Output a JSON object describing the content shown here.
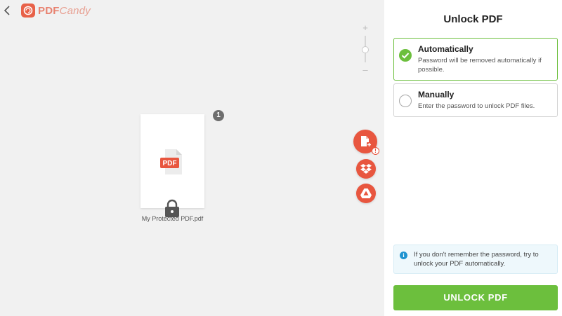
{
  "header": {
    "logo_text_main": "PDF",
    "logo_text_script": "Candy"
  },
  "workspace": {
    "zoom_plus": "+",
    "zoom_minus": "–",
    "zoom_level": 0.5,
    "file_count": "1",
    "file_name": "My Protected PDF.pdf",
    "file_type_label": "PDF",
    "add_warning": "!"
  },
  "panel": {
    "title": "Unlock PDF",
    "options": [
      {
        "title": "Automatically",
        "description": "Password will be removed automatically if possible.",
        "selected": true
      },
      {
        "title": "Manually",
        "description": "Enter the password to unlock PDF files.",
        "selected": false
      }
    ],
    "info_icon": "i",
    "info_text": "If you don't remember the password, try to unlock your PDF automatically.",
    "unlock_button": "UNLOCK PDF"
  },
  "colors": {
    "brand": "#e8563f",
    "accent_green": "#6cbf3d",
    "info_blue": "#1f93d0"
  },
  "icons": [
    "back-icon",
    "pdfcandy-logo-icon",
    "pdf-file-icon",
    "lock-icon",
    "add-file-icon",
    "dropbox-icon",
    "google-drive-icon",
    "check-icon",
    "info-icon"
  ]
}
